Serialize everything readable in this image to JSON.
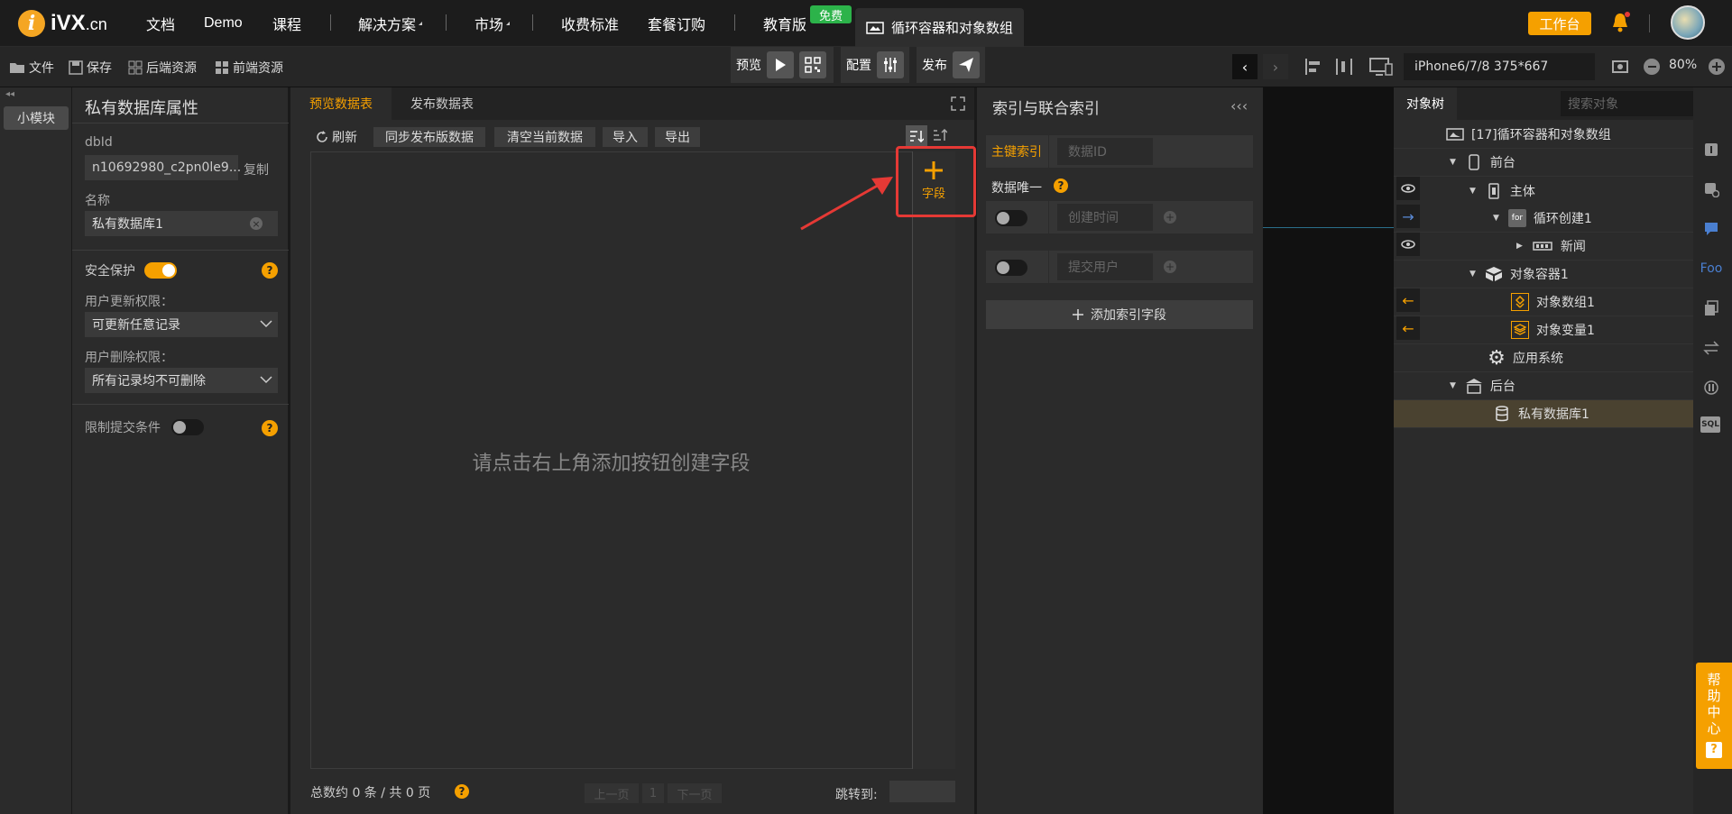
{
  "header": {
    "logo_brand": "iVX",
    "logo_domain": ".cn",
    "nav": [
      "文档",
      "Demo",
      "课程",
      "解决方案",
      "市场",
      "收费标准",
      "套餐订购",
      "教育版"
    ],
    "free_badge": "免费",
    "doc_tab": "循环容器和对象数组",
    "workbench": "工作台"
  },
  "toolbar": {
    "file": "文件",
    "save": "保存",
    "backend_res": "后端资源",
    "frontend_res": "前端资源",
    "preview": "预览",
    "config": "配置",
    "publish": "发布",
    "device": "iPhone6/7/8 375*667",
    "zoom": "80%"
  },
  "left_strip": {
    "module_btn": "小模块"
  },
  "props": {
    "title": "私有数据库属性",
    "dbid_label": "dbId",
    "dbid_value": "n10692980_c2pn0le9...",
    "copy": "复制",
    "name_label": "名称",
    "name_value": "私有数据库1",
    "safe_label": "安全保护",
    "update_label": "用户更新权限：",
    "update_value": "可更新任意记录",
    "delete_label": "用户删除权限：",
    "delete_value": "所有记录均不可删除",
    "limit_label": "限制提交条件",
    "help_q": "?"
  },
  "center": {
    "tab_preview": "预览数据表",
    "tab_publish": "发布数据表",
    "refresh": "刷新",
    "sync": "同步发布版数据",
    "clear": "清空当前数据",
    "import": "导入",
    "export": "导出",
    "empty_msg": "请点击右上角添加按钮创建字段",
    "add_field": "字段",
    "total": "总数约 0 条 / 共 0 页",
    "prev": "上一页",
    "page": "1",
    "next": "下一页",
    "jump": "跳转到:"
  },
  "index": {
    "title": "索引与联合索引",
    "primary": "主键索引",
    "primary_ph": "数据ID",
    "unique": "数据唯一",
    "f1": "创建时间",
    "f2": "提交用户",
    "add": "添加索引字段"
  },
  "tree": {
    "tab": "对象树",
    "search_ph": "搜索对象",
    "rows": [
      "[17]循环容器和对象数组",
      "前台",
      "主体",
      "循环创建1",
      "新闻",
      "对象容器1",
      "对象数组1",
      "对象变量1",
      "应用系统",
      "后台",
      "私有数据库1"
    ],
    "for_badge": "for"
  },
  "right_icons": {
    "sql": "SQL",
    "foo": "Foo"
  },
  "help_center": "帮助中心",
  "colors": {
    "accent": "#f5a000",
    "highlight": "#e53935",
    "free": "#2cb34a"
  }
}
